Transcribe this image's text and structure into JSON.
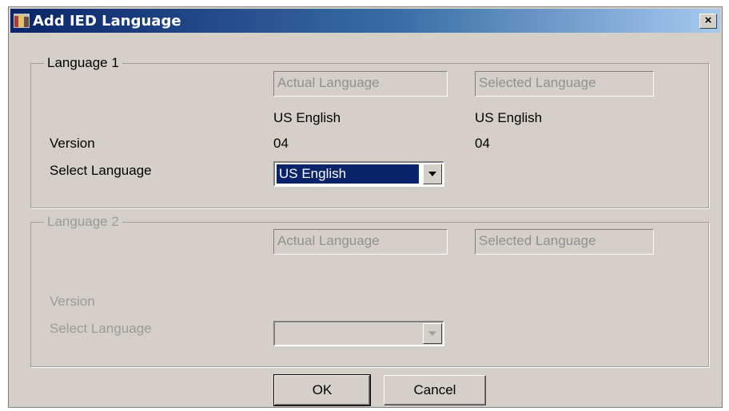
{
  "window": {
    "title": "Add IED Language",
    "close_symbol": "×"
  },
  "group1": {
    "title": "Language 1",
    "actual_placeholder": "Actual Language",
    "selected_placeholder": "Selected Language",
    "actual_language": "US English",
    "selected_language": "US English",
    "version_label": "Version",
    "actual_version": "04",
    "selected_version": "04",
    "select_label": "Select Language",
    "select_value": "US English"
  },
  "group2": {
    "title": "Language 2",
    "actual_placeholder": "Actual Language",
    "selected_placeholder": "Selected Language",
    "version_label": "Version",
    "select_label": "Select Language",
    "select_value": ""
  },
  "buttons": {
    "ok": "OK",
    "cancel": "Cancel"
  },
  "colors": {
    "titlebar_start": "#0a246a",
    "titlebar_end": "#a6caf0",
    "face": "#d4d0c8",
    "selection": "#0a246a"
  },
  "icons": {
    "app": "app-icon",
    "close": "close-icon",
    "dropdown": "chevron-down-icon"
  }
}
